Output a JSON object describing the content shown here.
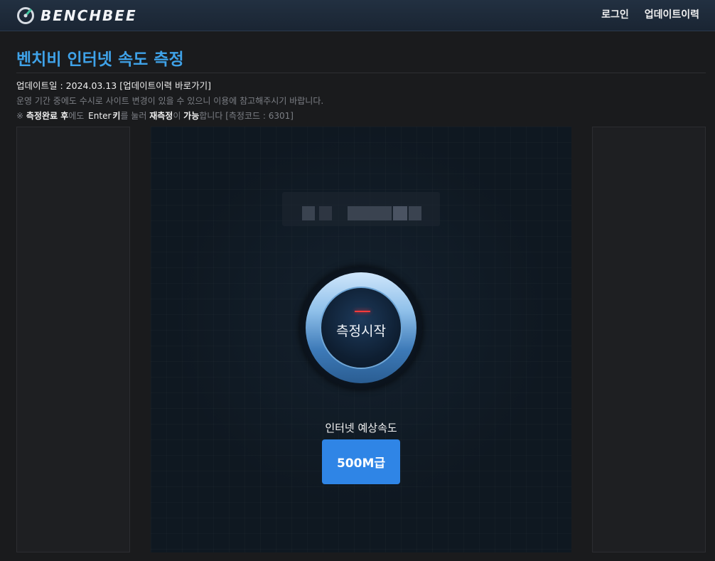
{
  "header": {
    "logo_text": "BENCHBEE",
    "nav": [
      "로그인",
      "업데이트이력"
    ]
  },
  "page": {
    "title": "벤치비 인터넷 속도 측정",
    "update_label": "업데이트일 : 2024.03.13",
    "update_link": "[업데이트이력 바로가기]",
    "notice": "운영 기간 중에도 수시로 사이트 변경이 있을 수 있으니 이용에 참고해주시기 바랍니다.",
    "hint": {
      "prefix": "※ ",
      "bold1": "측정완료 후",
      "t1": "에도 ",
      "key": "Enter",
      "bold2": "키",
      "t2": "를 눌러 ",
      "bold3": "재측정",
      "t3": "이 ",
      "bold4": "가능",
      "t4": "합니다 [측정코드 : 6301]"
    }
  },
  "measure": {
    "start_label": "측정시작",
    "speed_caption": "인터넷 예상속도",
    "speed_value": "500M급"
  },
  "colors": {
    "title": "#3fa2e8",
    "speed_button": "#2f85e6",
    "header_bg": "#1f2c3b"
  }
}
